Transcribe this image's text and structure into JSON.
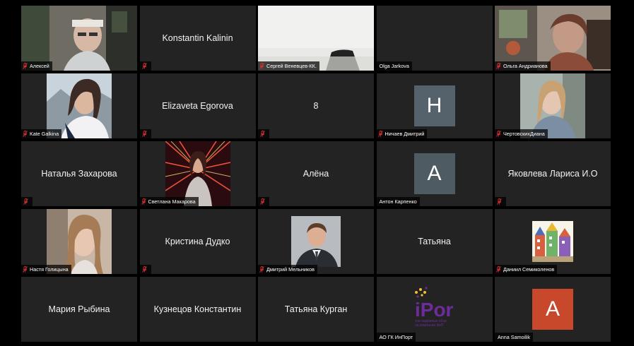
{
  "colors": {
    "tile_bg": "#232323",
    "muted_mic": "#e0302f",
    "avatar_h": "#55626b",
    "avatar_a1": "#4f5b62",
    "avatar_a2": "#c8482c",
    "logo_purple": "#6d2b9b",
    "logo_yellow": "#f2c02e"
  },
  "tiles": [
    {
      "label": "Алексей",
      "center": "",
      "type": "photo",
      "icon": "person-photo"
    },
    {
      "label": "",
      "center": "Konstantin Kalinin",
      "type": "name"
    },
    {
      "label": "Сергей Веневцев-КК.",
      "center": "",
      "type": "photo",
      "icon": "room-photo"
    },
    {
      "label": "Olga Jarkova",
      "center": "",
      "type": "blank"
    },
    {
      "label": "Ольга Андрианова",
      "center": "",
      "type": "photo",
      "icon": "person-photo"
    },
    {
      "label": "Kate Galkina",
      "center": "",
      "type": "photo",
      "icon": "person-photo"
    },
    {
      "label": "",
      "center": "Elizaveta Egorova",
      "type": "name"
    },
    {
      "label": "",
      "center": "8",
      "type": "name"
    },
    {
      "label": "Ничаев Дмитрий",
      "center": "",
      "type": "avatar",
      "letter": "H"
    },
    {
      "label": "ЧертовскихДиана",
      "center": "",
      "type": "photo",
      "icon": "person-photo"
    },
    {
      "label": "",
      "center": "Наталья Захарова",
      "type": "name"
    },
    {
      "label": "Светлана Макарова",
      "center": "",
      "type": "photo",
      "icon": "person-photo"
    },
    {
      "label": "",
      "center": "Алёна",
      "type": "name"
    },
    {
      "label": "Антон Карпенко",
      "center": "",
      "type": "avatar",
      "letter": "A"
    },
    {
      "label": "",
      "center": "Яковлева Лариса И.О",
      "type": "name"
    },
    {
      "label": "Настя Голицына",
      "center": "",
      "type": "photo",
      "icon": "person-photo"
    },
    {
      "label": "",
      "center": "Кристина Дудко",
      "type": "name"
    },
    {
      "label": "Дмитрий Мельников",
      "center": "",
      "type": "photo",
      "icon": "person-photo"
    },
    {
      "label": "",
      "center": "Татьяна",
      "type": "name"
    },
    {
      "label": "Даниил Семиколенов",
      "center": "",
      "type": "photo",
      "icon": "drawing-photo"
    },
    {
      "label": "",
      "center": "Мария Рыбина",
      "type": "name"
    },
    {
      "label": "",
      "center": "Кузнецов Константин",
      "type": "name"
    },
    {
      "label": "",
      "center": "Татьяна Курган",
      "type": "name"
    },
    {
      "label": "АО ГК ИнПорт",
      "center": "",
      "type": "logo",
      "logo_text": "iPor",
      "logo_sub1": "тов надежных сбор",
      "logo_sub2": "па компании ИнП"
    },
    {
      "label": "Anna Samoilik",
      "center": "",
      "type": "avatar",
      "letter": "A"
    }
  ]
}
